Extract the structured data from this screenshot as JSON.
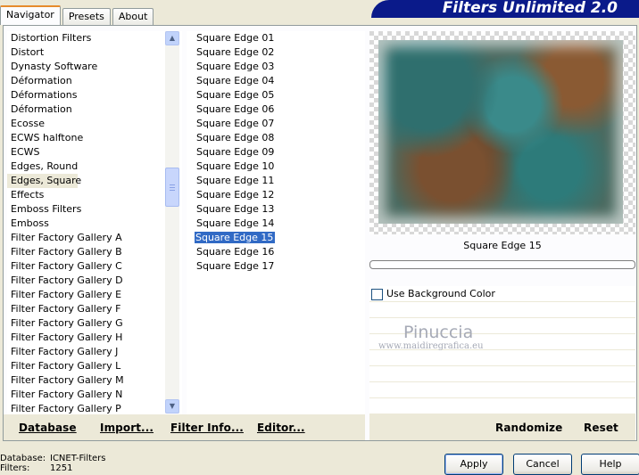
{
  "tabs": [
    "Navigator",
    "Presets",
    "About"
  ],
  "app_title": "Filters Unlimited 2.0",
  "categories": [
    "Distortion Filters",
    "Distort",
    "Dynasty Software",
    "Déformation",
    "Déformations",
    "Déformation",
    "Ecosse",
    "ECWS halftone",
    "ECWS",
    "Edges, Round",
    "Edges, Square",
    "Effects",
    "Emboss Filters",
    "Emboss",
    "Filter Factory Gallery A",
    "Filter Factory Gallery B",
    "Filter Factory Gallery C",
    "Filter Factory Gallery D",
    "Filter Factory Gallery E",
    "Filter Factory Gallery F",
    "Filter Factory Gallery G",
    "Filter Factory Gallery H",
    "Filter Factory Gallery J",
    "Filter Factory Gallery L",
    "Filter Factory Gallery M",
    "Filter Factory Gallery N",
    "Filter Factory Gallery P"
  ],
  "selected_category": "Edges, Square",
  "filters": [
    "Square Edge 01",
    "Square Edge 02",
    "Square Edge 03",
    "Square Edge 04",
    "Square Edge 05",
    "Square Edge 06",
    "Square Edge 07",
    "Square Edge 08",
    "Square Edge 09",
    "Square Edge 10",
    "Square Edge 11",
    "Square Edge 12",
    "Square Edge 13",
    "Square Edge 14",
    "Square Edge 15",
    "Square Edge 16",
    "Square Edge 17"
  ],
  "selected_filter": "Square Edge 15",
  "left_buttons": {
    "database": "Database",
    "import": "Import...",
    "filter_info": "Filter Info...",
    "editor": "Editor..."
  },
  "preview": {
    "name": "Square Edge 15",
    "use_background_label": "Use Background Color",
    "use_background_checked": false
  },
  "watermark": {
    "name": "Pinuccia",
    "url": "www.maidiregrafica.eu"
  },
  "right_buttons": {
    "randomize": "Randomize",
    "reset": "Reset"
  },
  "status": {
    "database_label": "Database:",
    "database_value": "ICNET-Filters",
    "filters_label": "Filters:",
    "filters_value": "1251"
  },
  "dialog_buttons": {
    "apply": "Apply",
    "cancel": "Cancel",
    "help": "Help"
  }
}
